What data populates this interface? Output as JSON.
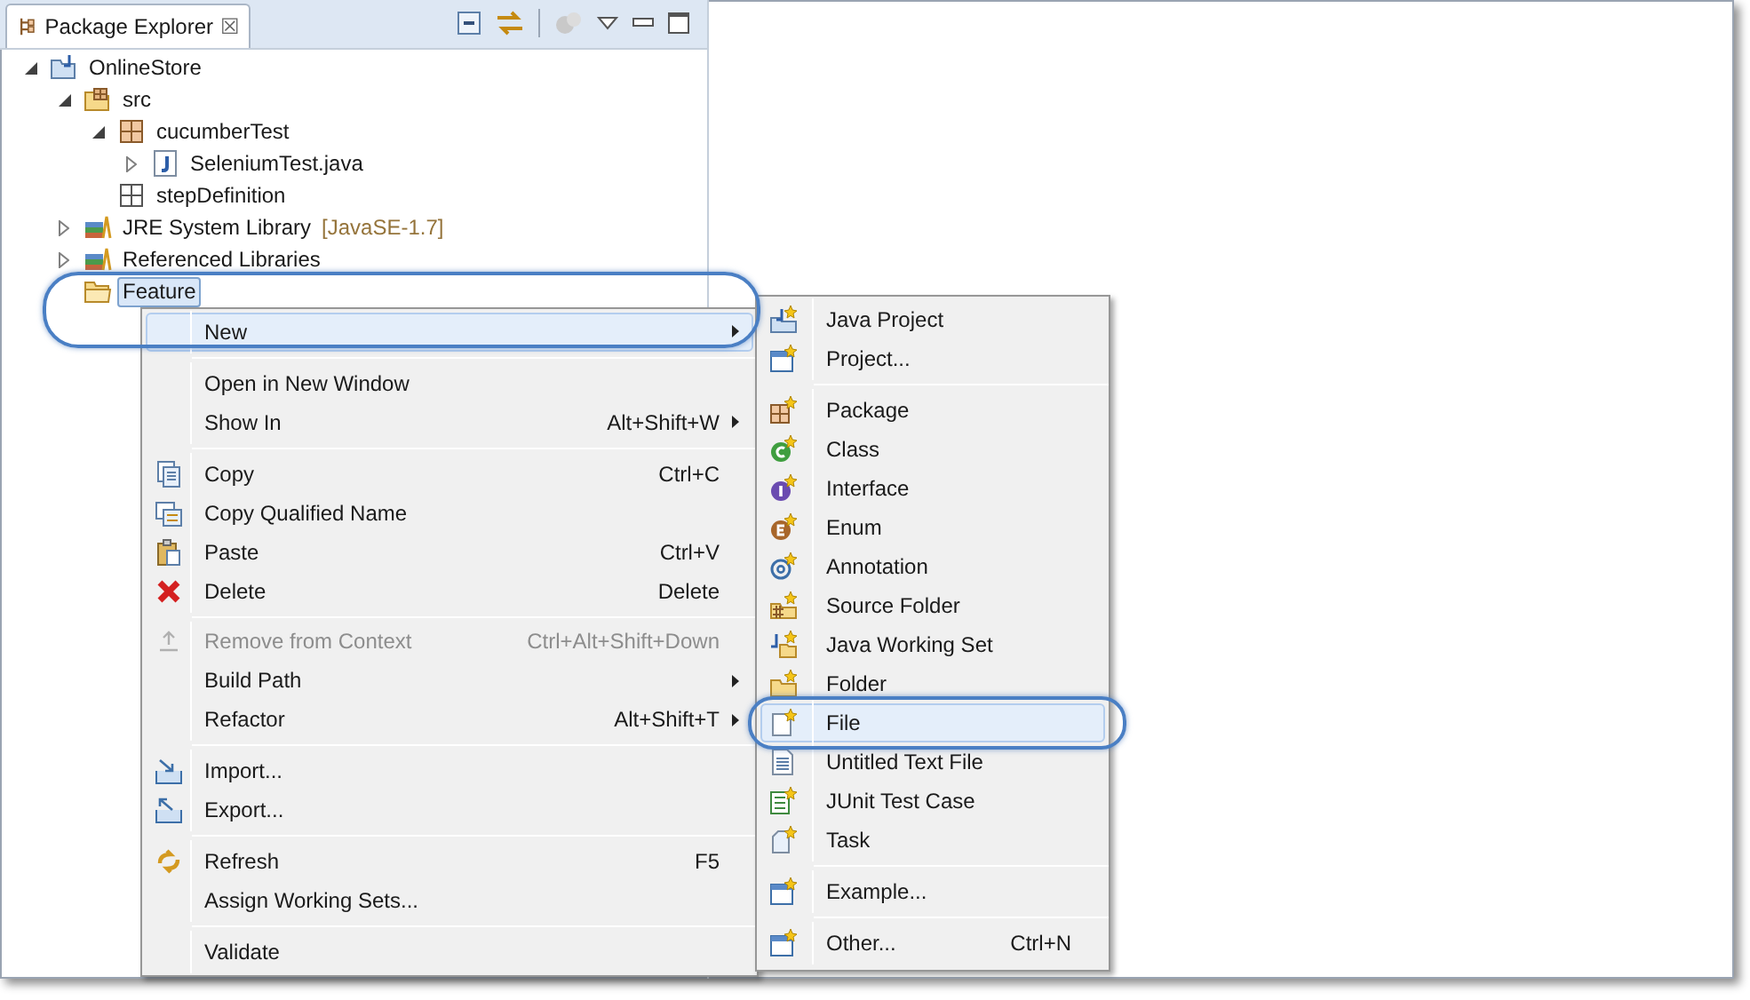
{
  "view": {
    "tab": {
      "title": "Package Explorer",
      "close": "☒",
      "selected": true
    }
  },
  "tree": [
    {
      "label": "OnlineStore",
      "expanded": true,
      "selected": false,
      "children": [
        {
          "label": "src",
          "expanded": true,
          "selected": false,
          "children": [
            {
              "label": "cucumberTest",
              "expanded": true,
              "selected": false,
              "children": [
                {
                  "label": "SeleniumTest.java",
                  "expanded": false,
                  "selected": false
                }
              ]
            },
            {
              "label": "stepDefinition",
              "selected": false
            }
          ]
        },
        {
          "label": "JRE System Library",
          "decoration": "[JavaSE-1.7]",
          "expanded": false,
          "selected": false
        },
        {
          "label": "Referenced Libraries",
          "expanded": false,
          "selected": false
        },
        {
          "label": "Feature",
          "selected": true
        }
      ]
    }
  ],
  "context_menu": [
    {
      "kind": "item",
      "label": "New",
      "submenu": true,
      "selected": true,
      "disabled": false
    },
    {
      "kind": "separator"
    },
    {
      "kind": "item",
      "label": "Open in New Window",
      "selected": false,
      "disabled": false
    },
    {
      "kind": "item",
      "label": "Show In",
      "shortcut": "Alt+Shift+W",
      "submenu": true,
      "selected": false,
      "disabled": false
    },
    {
      "kind": "separator"
    },
    {
      "kind": "item",
      "label": "Copy",
      "shortcut": "Ctrl+C",
      "selected": false,
      "disabled": false
    },
    {
      "kind": "item",
      "label": "Copy Qualified Name",
      "selected": false,
      "disabled": false
    },
    {
      "kind": "item",
      "label": "Paste",
      "shortcut": "Ctrl+V",
      "selected": false,
      "disabled": false
    },
    {
      "kind": "item",
      "label": "Delete",
      "shortcut": "Delete",
      "selected": false,
      "disabled": false
    },
    {
      "kind": "separator"
    },
    {
      "kind": "item",
      "label": "Remove from Context",
      "shortcut": "Ctrl+Alt+Shift+Down",
      "selected": false,
      "disabled": true
    },
    {
      "kind": "item",
      "label": "Build Path",
      "submenu": true,
      "selected": false,
      "disabled": false
    },
    {
      "kind": "item",
      "label": "Refactor",
      "shortcut": "Alt+Shift+T",
      "submenu": true,
      "selected": false,
      "disabled": false
    },
    {
      "kind": "separator"
    },
    {
      "kind": "item",
      "label": "Import...",
      "selected": false,
      "disabled": false
    },
    {
      "kind": "item",
      "label": "Export...",
      "selected": false,
      "disabled": false
    },
    {
      "kind": "separator"
    },
    {
      "kind": "item",
      "label": "Refresh",
      "shortcut": "F5",
      "selected": false,
      "disabled": false
    },
    {
      "kind": "item",
      "label": "Assign Working Sets...",
      "selected": false,
      "disabled": false
    },
    {
      "kind": "separator"
    },
    {
      "kind": "item",
      "label": "Validate",
      "selected": false,
      "disabled": false
    }
  ],
  "new_submenu": [
    {
      "kind": "item",
      "label": "Java Project",
      "selected": false
    },
    {
      "kind": "item",
      "label": "Project...",
      "selected": false
    },
    {
      "kind": "separator"
    },
    {
      "kind": "item",
      "label": "Package",
      "selected": false
    },
    {
      "kind": "item",
      "label": "Class",
      "selected": false
    },
    {
      "kind": "item",
      "label": "Interface",
      "selected": false
    },
    {
      "kind": "item",
      "label": "Enum",
      "selected": false
    },
    {
      "kind": "item",
      "label": "Annotation",
      "selected": false
    },
    {
      "kind": "item",
      "label": "Source Folder",
      "selected": false
    },
    {
      "kind": "item",
      "label": "Java Working Set",
      "selected": false
    },
    {
      "kind": "item",
      "label": "Folder",
      "selected": false
    },
    {
      "kind": "item",
      "label": "File",
      "selected": true
    },
    {
      "kind": "item",
      "label": "Untitled Text File",
      "selected": false
    },
    {
      "kind": "item",
      "label": "JUnit Test Case",
      "selected": false
    },
    {
      "kind": "item",
      "label": "Task",
      "selected": false
    },
    {
      "kind": "separator"
    },
    {
      "kind": "item",
      "label": "Example...",
      "selected": false
    },
    {
      "kind": "separator"
    },
    {
      "kind": "item",
      "label": "Other...",
      "shortcut": "Ctrl+N",
      "selected": false
    }
  ]
}
